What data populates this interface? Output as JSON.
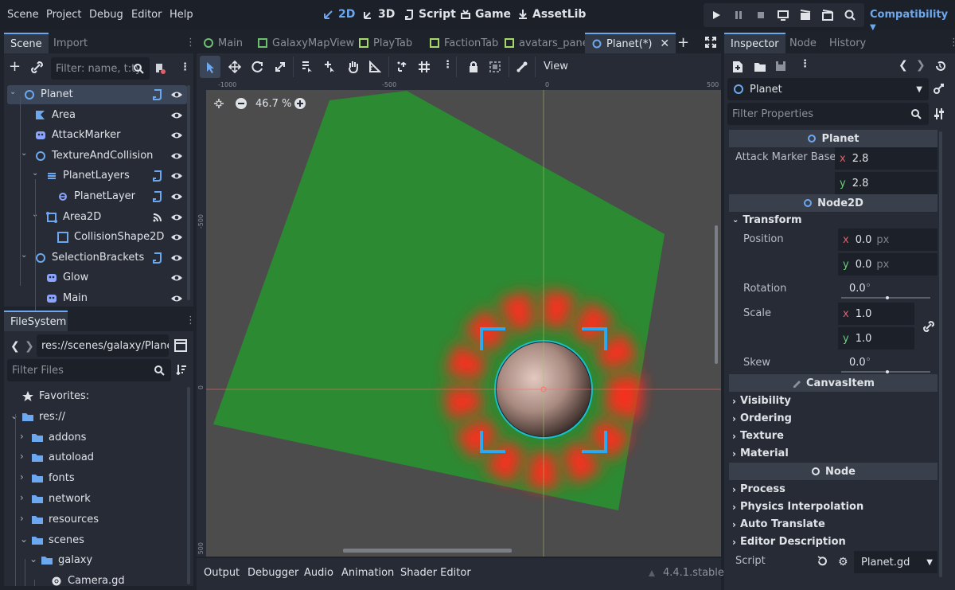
{
  "menu": [
    "Scene",
    "Project",
    "Debug",
    "Editor",
    "Help"
  ],
  "workspaces": {
    "w2d": "2D",
    "w3d": "3D",
    "script": "Script",
    "game": "Game",
    "assetlib": "AssetLib"
  },
  "renderer": "Compatibility",
  "scene_dock": {
    "tabs": [
      "Scene",
      "Import"
    ],
    "filter_placeholder": "Filter: name, t:ty",
    "nodes": [
      {
        "label": "Planet",
        "icon": "node2d-icon",
        "indent": 0
      },
      {
        "label": "Area",
        "icon": "area-icon",
        "indent": 1
      },
      {
        "label": "AttackMarker",
        "icon": "sprite-icon",
        "indent": 1
      },
      {
        "label": "TextureAndCollision",
        "icon": "node2d-icon",
        "indent": 1
      },
      {
        "label": "PlanetLayers",
        "icon": "layers-icon",
        "indent": 2
      },
      {
        "label": "PlanetLayer",
        "icon": "layer-icon",
        "indent": 3
      },
      {
        "label": "Area2D",
        "icon": "area2d-icon",
        "indent": 2
      },
      {
        "label": "CollisionShape2D",
        "icon": "collision-shape-icon",
        "indent": 3
      },
      {
        "label": "SelectionBrackets",
        "icon": "node2d-icon",
        "indent": 1
      },
      {
        "label": "Glow",
        "icon": "sprite-icon",
        "indent": 2
      },
      {
        "label": "Main",
        "icon": "sprite-icon",
        "indent": 2
      }
    ]
  },
  "filesystem": {
    "title": "FileSystem",
    "path": "res://scenes/galaxy/Planet",
    "filter_placeholder": "Filter Files",
    "items": [
      {
        "label": "Favorites:",
        "icon": "star-icon"
      },
      {
        "label": "res://",
        "icon": "folder-icon"
      },
      {
        "label": "addons",
        "icon": "folder-icon"
      },
      {
        "label": "autoload",
        "icon": "folder-icon"
      },
      {
        "label": "fonts",
        "icon": "folder-icon"
      },
      {
        "label": "network",
        "icon": "folder-icon"
      },
      {
        "label": "resources",
        "icon": "folder-icon"
      },
      {
        "label": "scenes",
        "icon": "folder-icon"
      },
      {
        "label": "galaxy",
        "icon": "folder-icon"
      },
      {
        "label": "Camera.gd",
        "icon": "gear-icon"
      }
    ]
  },
  "scene_tabs": [
    "Main",
    "GalaxyMapView",
    "PlayTab",
    "FactionTab",
    "avatars_panel",
    "Planet(*)"
  ],
  "viewport": {
    "zoom": "46.7 %",
    "view_menu": "View",
    "ruler_top": [
      "-1000",
      "-500",
      "0",
      "500"
    ],
    "ruler_left": [
      "-500",
      "0",
      "500"
    ]
  },
  "bottom_tabs": [
    "Output",
    "Debugger",
    "Audio",
    "Animation",
    "Shader Editor"
  ],
  "version": "4.4.1.stable",
  "inspector": {
    "tabs": [
      "Inspector",
      "Node",
      "History"
    ],
    "object": "Planet",
    "filter_placeholder": "Filter Properties",
    "planet_header": "Planet",
    "attack_marker_label": "Attack Marker Base",
    "attack_x": "2.8",
    "attack_y": "2.8",
    "node2d_header": "Node2D",
    "transform": "Transform",
    "position_label": "Position",
    "pos_x": "0.0",
    "pos_y": "0.0",
    "px": "px",
    "rotation_label": "Rotation",
    "rotation": "0.0",
    "scale_label": "Scale",
    "scale_x": "1.0",
    "scale_y": "1.0",
    "skew_label": "Skew",
    "skew": "0.0",
    "degree": "°",
    "canvasitem_header": "CanvasItem",
    "sections_ci": [
      "Visibility",
      "Ordering",
      "Texture",
      "Material"
    ],
    "node_header": "Node",
    "sections_node": [
      "Process",
      "Physics Interpolation",
      "Auto Translate",
      "Editor Description"
    ],
    "script_label": "Script",
    "script_value": "Planet.gd",
    "axis_x": "x",
    "axis_y": "y"
  },
  "colors": {
    "accent": "#6ca8f0",
    "green_area": "#2c8a32",
    "glow": "#ff2a1a",
    "bracket": "#2aa8f0"
  }
}
